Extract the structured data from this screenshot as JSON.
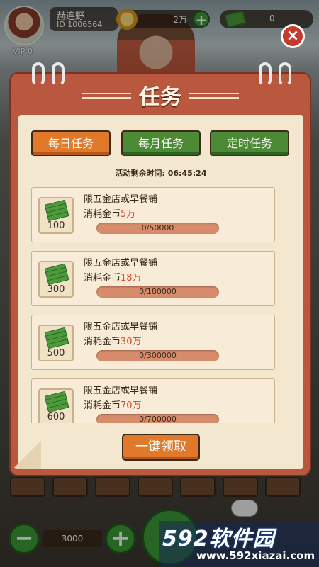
{
  "header": {
    "player_name": "赫连野",
    "player_id": "ID 1006564",
    "vip": "VIP 0",
    "coins": "2万",
    "cash": "0"
  },
  "modal": {
    "title": "任务",
    "close_glyph": "×",
    "tabs": [
      {
        "label": "每日任务",
        "active": true
      },
      {
        "label": "每月任务",
        "active": false
      },
      {
        "label": "定时任务",
        "active": false
      }
    ],
    "timer_label": "活动剩余时间: ",
    "timer_value": "06:45:24",
    "tasks": [
      {
        "title": "限五金店或早餐铺",
        "desc_prefix": "消耗金币",
        "desc_amount": "5万",
        "reward": "100",
        "progress_text": "0/50000",
        "progress": 0
      },
      {
        "title": "限五金店或早餐铺",
        "desc_prefix": "消耗金币",
        "desc_amount": "18万",
        "reward": "300",
        "progress_text": "0/180000",
        "progress": 0
      },
      {
        "title": "限五金店或早餐铺",
        "desc_prefix": "消耗金币",
        "desc_amount": "30万",
        "reward": "500",
        "progress_text": "0/300000",
        "progress": 0
      },
      {
        "title": "限五金店或早餐铺",
        "desc_prefix": "消耗金币",
        "desc_amount": "70万",
        "reward": "600",
        "progress_text": "0/700000",
        "progress": 0
      }
    ],
    "claim_all_label": "一键领取"
  },
  "bottom": {
    "quantity": "3000",
    "minus_glyph": "−",
    "plus_glyph": "+"
  },
  "watermark": {
    "brand": "592软件园",
    "url": "www.592xiazai.com"
  },
  "colors": {
    "tab_active": "#e07a2a",
    "tab_inactive": "#4c8a36",
    "highlight_amount": "#e0442a",
    "frame": "#b9573f"
  },
  "icons": [
    "avatar",
    "coin-icon",
    "cash-icon",
    "plus-icon",
    "close-icon",
    "money-icon",
    "controller-icon"
  ]
}
